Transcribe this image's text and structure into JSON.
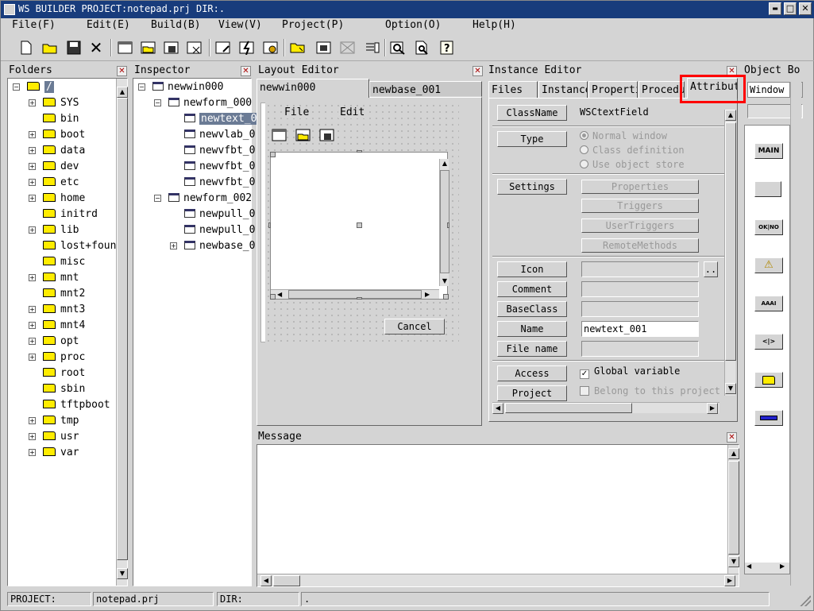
{
  "title": "WS BUILDER PROJECT:notepad.prj DIR:.",
  "window_controls": {
    "minimize": "▬",
    "maximize": "□",
    "close": "✕"
  },
  "menu": [
    "File(F)",
    "Edit(E)",
    "Build(B)",
    "View(V)",
    "Project(P)",
    "Option(O)",
    "Help(H)"
  ],
  "toolbar_icons": [
    "new-file-icon",
    "open-folder-icon",
    "save-icon",
    "cut-icon",
    "new-window-icon",
    "open-window-icon",
    "save-window-icon",
    "close-window-icon",
    "edit-icon",
    "build-icon",
    "run-icon",
    "folder-icon",
    "grid-icon",
    "align-icon",
    "list-icon",
    "search-icon",
    "preview-icon",
    "help-icon"
  ],
  "folders": {
    "title": "Folders",
    "items": [
      {
        "label": "/",
        "expand": "-",
        "level": 0,
        "selected": true
      },
      {
        "label": "SYS",
        "expand": "+",
        "level": 1
      },
      {
        "label": "bin",
        "expand": "",
        "level": 1
      },
      {
        "label": "boot",
        "expand": "+",
        "level": 1
      },
      {
        "label": "data",
        "expand": "+",
        "level": 1
      },
      {
        "label": "dev",
        "expand": "+",
        "level": 1
      },
      {
        "label": "etc",
        "expand": "+",
        "level": 1
      },
      {
        "label": "home",
        "expand": "+",
        "level": 1
      },
      {
        "label": "initrd",
        "expand": "",
        "level": 1
      },
      {
        "label": "lib",
        "expand": "+",
        "level": 1
      },
      {
        "label": "lost+found",
        "expand": "",
        "level": 1
      },
      {
        "label": "misc",
        "expand": "",
        "level": 1
      },
      {
        "label": "mnt",
        "expand": "+",
        "level": 1
      },
      {
        "label": "mnt2",
        "expand": "",
        "level": 1
      },
      {
        "label": "mnt3",
        "expand": "+",
        "level": 1
      },
      {
        "label": "mnt4",
        "expand": "+",
        "level": 1
      },
      {
        "label": "opt",
        "expand": "+",
        "level": 1
      },
      {
        "label": "proc",
        "expand": "+",
        "level": 1
      },
      {
        "label": "root",
        "expand": "",
        "level": 1
      },
      {
        "label": "sbin",
        "expand": "",
        "level": 1
      },
      {
        "label": "tftpboot",
        "expand": "",
        "level": 1
      },
      {
        "label": "tmp",
        "expand": "+",
        "level": 1
      },
      {
        "label": "usr",
        "expand": "+",
        "level": 1
      },
      {
        "label": "var",
        "expand": "+",
        "level": 1
      }
    ]
  },
  "inspector": {
    "title": "Inspector",
    "items": [
      {
        "label": "newwin000",
        "expand": "-",
        "level": 0
      },
      {
        "label": "newform_000",
        "expand": "-",
        "level": 1
      },
      {
        "label": "newtext_0",
        "expand": "",
        "level": 2,
        "selected": true
      },
      {
        "label": "newvlab_0",
        "expand": "",
        "level": 2
      },
      {
        "label": "newvfbt_0",
        "expand": "",
        "level": 2
      },
      {
        "label": "newvfbt_0",
        "expand": "",
        "level": 2
      },
      {
        "label": "newvfbt_0",
        "expand": "",
        "level": 2
      },
      {
        "label": "newform_002",
        "expand": "-",
        "level": 1
      },
      {
        "label": "newpull_0",
        "expand": "",
        "level": 2
      },
      {
        "label": "newpull_0",
        "expand": "",
        "level": 2
      },
      {
        "label": "newbase_0",
        "expand": "+",
        "level": 2
      }
    ]
  },
  "layout_editor": {
    "title": "Layout Editor",
    "tabs": [
      "newwin000",
      "newbase_001"
    ],
    "canvas_menu": [
      "File",
      "Edit"
    ],
    "cancel_label": "Cancel"
  },
  "instance_editor": {
    "title": "Instance Editor",
    "tabs": [
      "Files",
      "Instance",
      "Properti",
      "Procedu",
      "Attribut"
    ],
    "class_name_label": "ClassName",
    "class_name_value": "WSCtextField",
    "type_label": "Type",
    "type_options": [
      "Normal window",
      "Class definition",
      "Use object store"
    ],
    "settings_label": "Settings",
    "settings_buttons": [
      "Properties",
      "Triggers",
      "UserTriggers",
      "RemoteMethods"
    ],
    "icon_label": "Icon",
    "icon_browse": "..",
    "comment_label": "Comment",
    "baseclass_label": "BaseClass",
    "name_label": "Name",
    "name_value": "newtext_001",
    "filename_label": "File name",
    "access_label": "Access",
    "global_variable": "Global variable",
    "project_label": "Project",
    "belong_project": "Belong to this project"
  },
  "object_box": {
    "title": "Object Bo",
    "select_value": "Window",
    "items": [
      "MAIN",
      "",
      "OK|NO",
      "⚠",
      "AAAI",
      "<|>",
      "",
      ""
    ]
  },
  "message": {
    "title": "Message"
  },
  "status": {
    "project_label": "PROJECT:",
    "project_value": "notepad.prj",
    "dir_label": "DIR:",
    "dir_value": "."
  },
  "colors": {
    "titlebar": "#183c7c",
    "selection": "#6b7b95",
    "highlight_box": "#ff0000"
  }
}
